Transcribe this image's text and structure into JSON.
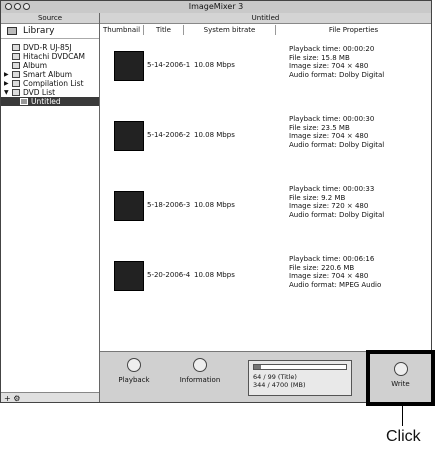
{
  "window": {
    "title": "ImageMixer 3"
  },
  "sidebar": {
    "header": "Source",
    "library": "Library",
    "items": [
      {
        "label": "DVD-R  UJ-85J",
        "icon": "disc-icon",
        "expander": ""
      },
      {
        "label": "Hitachi DVDCAM",
        "icon": "camera-icon",
        "expander": ""
      },
      {
        "label": "Album",
        "icon": "album-icon",
        "expander": ""
      },
      {
        "label": "Smart Album",
        "icon": "smart-album-icon",
        "expander": "▶"
      },
      {
        "label": "Compilation List",
        "icon": "list-icon",
        "expander": "▶"
      },
      {
        "label": "DVD List",
        "icon": "dvd-list-icon",
        "expander": "▼"
      },
      {
        "label": "Untitled",
        "icon": "dvd-icon",
        "expander": ""
      }
    ],
    "bottom_icons": "+  ⚙"
  },
  "main": {
    "header": "Untitled",
    "columns": [
      "Thumbnail",
      "Title",
      "System bitrate",
      "File Properties"
    ],
    "rows": [
      {
        "title": "5-14-2006-1",
        "bitrate": "10.08 Mbps",
        "props": [
          "Playback time: 00:00:20",
          "File size: 15.8 MB",
          "Image size: 704 × 480",
          "Audio format: Dolby Digital"
        ]
      },
      {
        "title": "5-14-2006-2",
        "bitrate": "10.08 Mbps",
        "props": [
          "Playback time: 00:00:30",
          "File size: 23.5 MB",
          "Image size: 704 × 480",
          "Audio format: Dolby Digital"
        ]
      },
      {
        "title": "5-18-2006-3",
        "bitrate": "10.08 Mbps",
        "props": [
          "Playback time: 00:00:33",
          "File size: 9.2 MB",
          "Image size: 720 × 480",
          "Audio format: Dolby Digital"
        ]
      },
      {
        "title": "5-20-2006-4",
        "bitrate": "10.08 Mbps",
        "props": [
          "Playback time: 00:06:16",
          "File size: 220.6 MB",
          "Image size: 704 × 480",
          "Audio format: MPEG Audio"
        ]
      }
    ]
  },
  "toolbar": {
    "playback": "Playback",
    "information": "Information",
    "usage_line1": "64 / 99 (Title)",
    "usage_line2": "344 / 4700 (MB)",
    "usage_fraction": 0.073,
    "write": "Write"
  },
  "annotation": {
    "label": "Click"
  }
}
